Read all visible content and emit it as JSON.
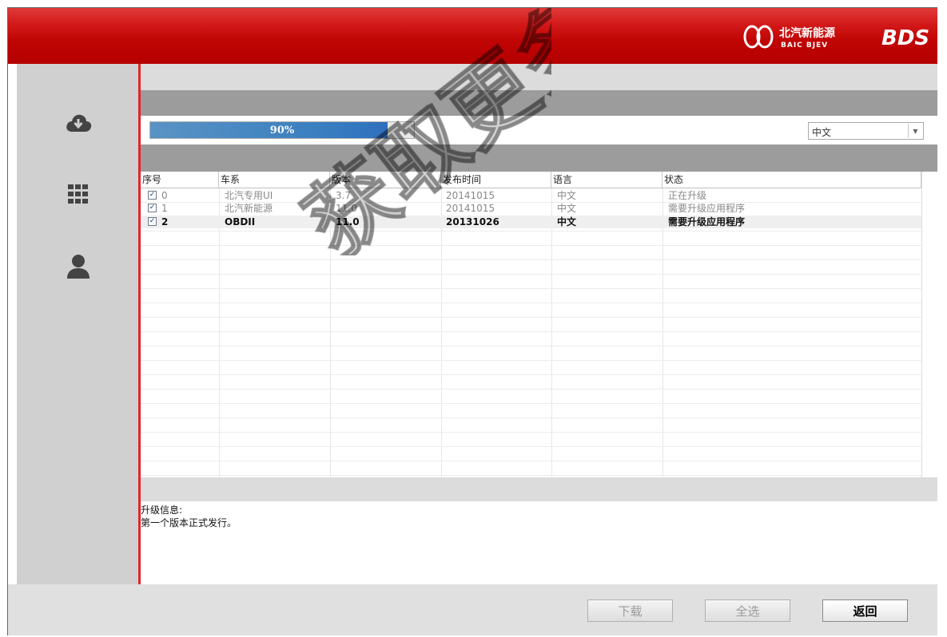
{
  "header": {
    "brand_cn": "北汽新能源",
    "brand_en": "BAIC BJEV",
    "app_name": "BDS",
    "colors": {
      "header": "#c00404",
      "accent": "#e0262a"
    }
  },
  "sidebar": {
    "items": [
      {
        "icon": "cloud-download-icon"
      },
      {
        "icon": "grid-apps-icon"
      },
      {
        "icon": "user-icon"
      }
    ]
  },
  "progress": {
    "value": 0.9,
    "label": "90%"
  },
  "language_select": {
    "value": "中文"
  },
  "table": {
    "columns": [
      "序号",
      "车系",
      "版本",
      "发布时间",
      "语言",
      "状态"
    ],
    "rows": [
      {
        "checked": true,
        "index": "0",
        "series": "北汽专用UI",
        "version": "3.7",
        "date": "20141015",
        "lang": "中文",
        "status": "正在升级"
      },
      {
        "checked": true,
        "index": "1",
        "series": "北汽新能源",
        "version": "11.0",
        "date": "20141015",
        "lang": "中文",
        "status": "需要升级应用程序"
      },
      {
        "checked": true,
        "index": "2",
        "series": "OBDII",
        "version": "11.0",
        "date": "20131026",
        "lang": "中文",
        "status": "需要升级应用程序"
      }
    ]
  },
  "info": {
    "title": "升级信息:",
    "text": "第一个版本正式发行。"
  },
  "footer": {
    "download_label": "下载",
    "select_all_label": "全选",
    "back_label": "返回"
  },
  "watermark": {
    "text": "获取更多"
  }
}
